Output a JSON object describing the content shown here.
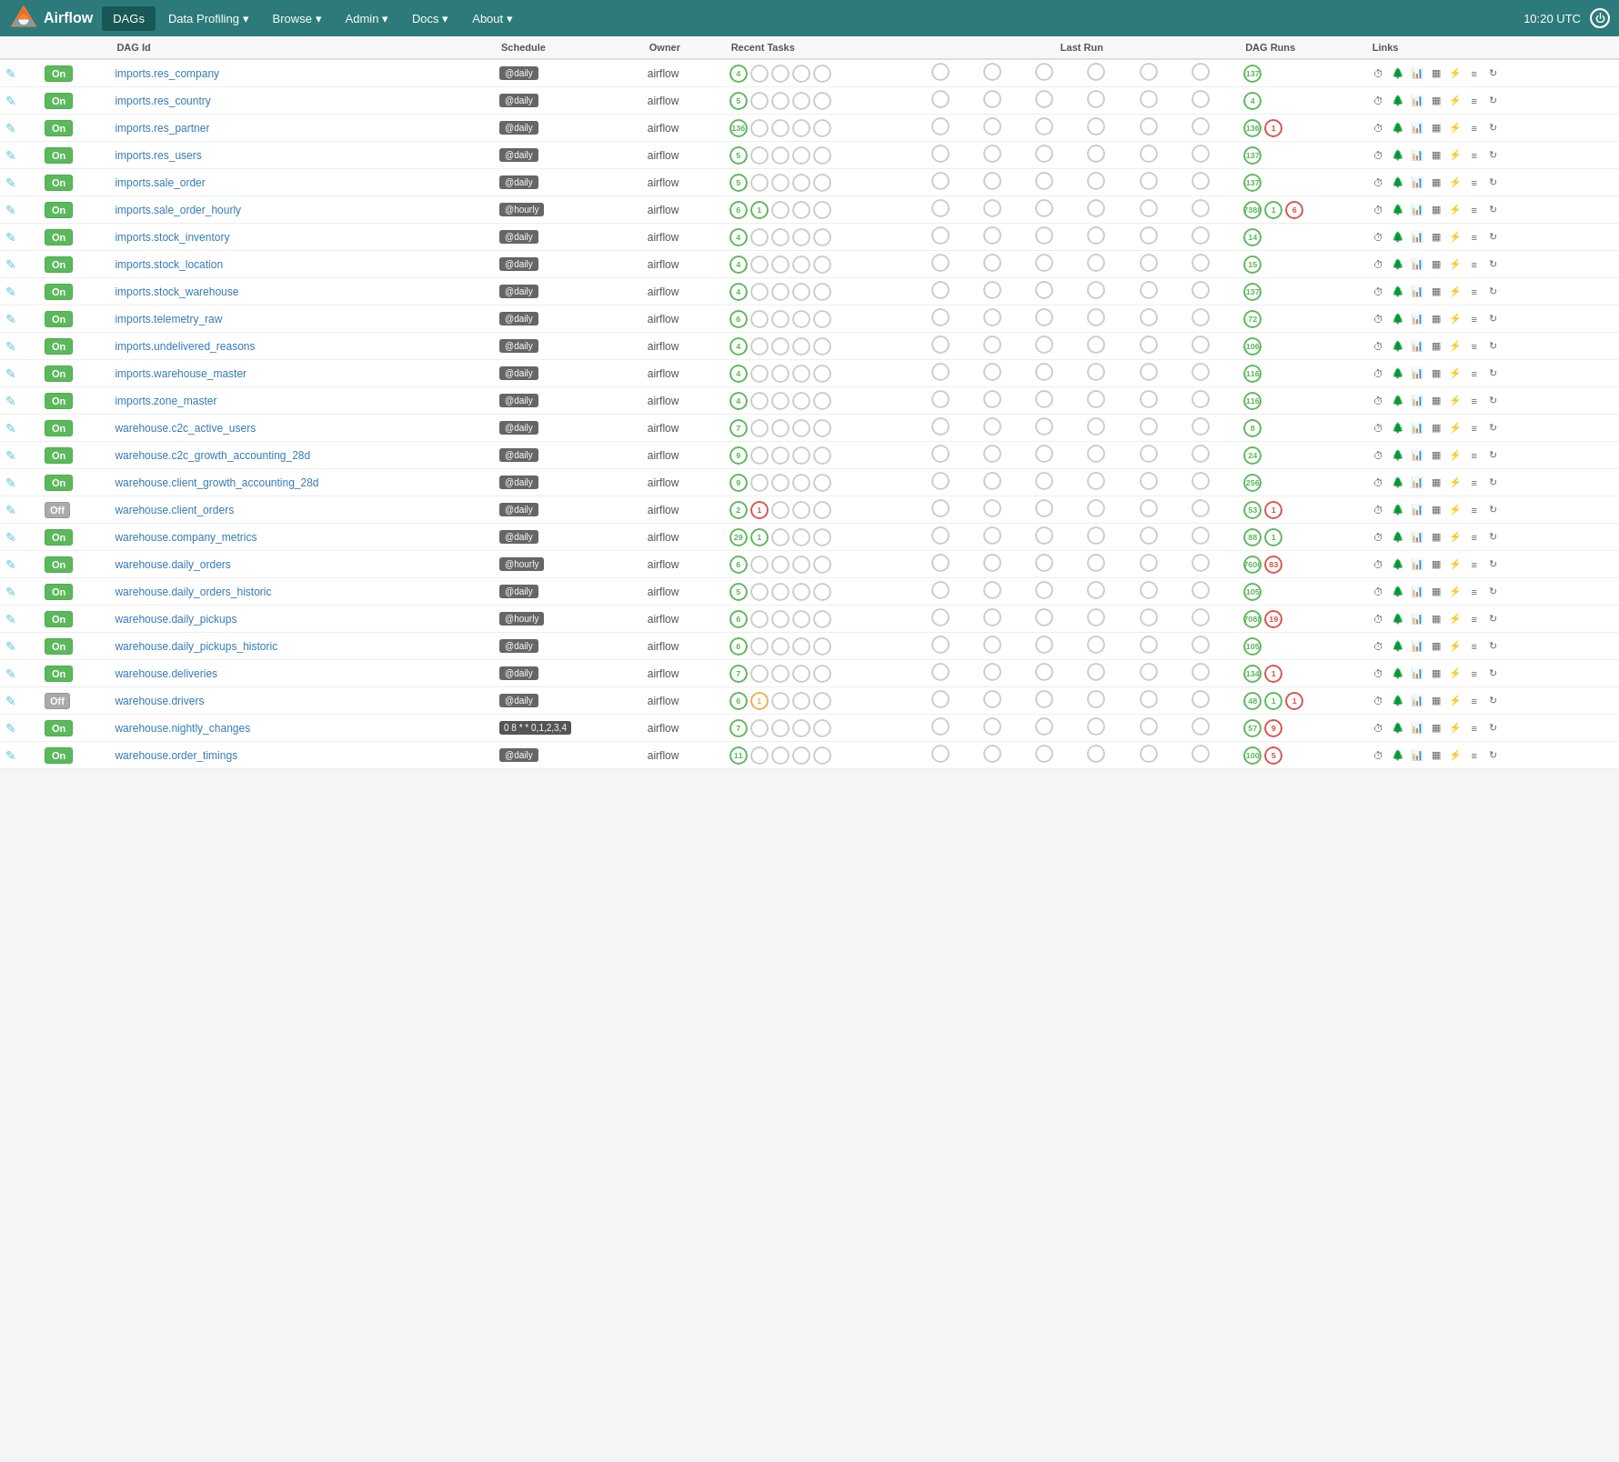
{
  "navbar": {
    "brand": "Airflow",
    "active_tab": "DAGs",
    "items": [
      {
        "label": "DAGs",
        "active": true
      },
      {
        "label": "Data Profiling ▾",
        "active": false
      },
      {
        "label": "Browse ▾",
        "active": false
      },
      {
        "label": "Admin ▾",
        "active": false
      },
      {
        "label": "Docs ▾",
        "active": false
      },
      {
        "label": "About ▾",
        "active": false
      }
    ],
    "time": "10:20 UTC"
  },
  "dags": [
    {
      "name": "imports.res_company",
      "toggle": "On",
      "schedule": "@daily",
      "owner": "airflow",
      "recent": [
        {
          "v": 4,
          "c": "green"
        }
      ],
      "last28": [
        {
          "v": 137,
          "c": "green"
        }
      ],
      "runs_extra": []
    },
    {
      "name": "imports.res_country",
      "toggle": "On",
      "schedule": "@daily",
      "owner": "airflow",
      "recent": [
        {
          "v": 5,
          "c": "green"
        }
      ],
      "last28": [
        {
          "v": 4,
          "c": "green"
        }
      ],
      "runs_extra": []
    },
    {
      "name": "imports.res_partner",
      "toggle": "On",
      "schedule": "@daily",
      "owner": "airflow",
      "recent": [
        {
          "v": 136,
          "c": "green"
        }
      ],
      "last28": [
        {
          "v": 136,
          "c": "green"
        },
        {
          "v": 1,
          "c": "red"
        }
      ],
      "runs_extra": []
    },
    {
      "name": "imports.res_users",
      "toggle": "On",
      "schedule": "@daily",
      "owner": "airflow",
      "recent": [
        {
          "v": 5,
          "c": "green"
        }
      ],
      "last28": [
        {
          "v": 137,
          "c": "green"
        }
      ],
      "runs_extra": []
    },
    {
      "name": "imports.sale_order",
      "toggle": "On",
      "schedule": "@daily",
      "owner": "airflow",
      "recent": [
        {
          "v": 5,
          "c": "green"
        }
      ],
      "last28": [
        {
          "v": 137,
          "c": "green"
        }
      ],
      "runs_extra": []
    },
    {
      "name": "imports.sale_order_hourly",
      "toggle": "On",
      "schedule": "@hourly",
      "owner": "airflow",
      "recent": [
        {
          "v": 6,
          "c": "green"
        },
        {
          "v": 1,
          "c": "green_outline"
        }
      ],
      "last28": [
        {
          "v": 7388,
          "c": "green"
        },
        {
          "v": 1,
          "c": "green_outline"
        },
        {
          "v": 6,
          "c": "red"
        }
      ],
      "runs_extra": []
    },
    {
      "name": "imports.stock_inventory",
      "toggle": "On",
      "schedule": "@daily",
      "owner": "airflow",
      "recent": [
        {
          "v": 4,
          "c": "green"
        }
      ],
      "last28": [
        {
          "v": 14,
          "c": "green"
        }
      ],
      "runs_extra": []
    },
    {
      "name": "imports.stock_location",
      "toggle": "On",
      "schedule": "@daily",
      "owner": "airflow",
      "recent": [
        {
          "v": 4,
          "c": "green"
        }
      ],
      "last28": [
        {
          "v": 15,
          "c": "green"
        }
      ],
      "runs_extra": []
    },
    {
      "name": "imports.stock_warehouse",
      "toggle": "On",
      "schedule": "@daily",
      "owner": "airflow",
      "recent": [
        {
          "v": 4,
          "c": "green"
        }
      ],
      "last28": [
        {
          "v": 137,
          "c": "green"
        }
      ],
      "runs_extra": []
    },
    {
      "name": "imports.telemetry_raw",
      "toggle": "On",
      "schedule": "@daily",
      "owner": "airflow",
      "recent": [
        {
          "v": 6,
          "c": "green"
        }
      ],
      "last28": [
        {
          "v": 72,
          "c": "green"
        }
      ],
      "runs_extra": []
    },
    {
      "name": "imports.undelivered_reasons",
      "toggle": "On",
      "schedule": "@daily",
      "owner": "airflow",
      "recent": [
        {
          "v": 4,
          "c": "green"
        }
      ],
      "last28": [
        {
          "v": 106,
          "c": "green"
        }
      ],
      "runs_extra": []
    },
    {
      "name": "imports.warehouse_master",
      "toggle": "On",
      "schedule": "@daily",
      "owner": "airflow",
      "recent": [
        {
          "v": 4,
          "c": "green"
        }
      ],
      "last28": [
        {
          "v": 116,
          "c": "green"
        }
      ],
      "runs_extra": []
    },
    {
      "name": "imports.zone_master",
      "toggle": "On",
      "schedule": "@daily",
      "owner": "airflow",
      "recent": [
        {
          "v": 4,
          "c": "green"
        }
      ],
      "last28": [
        {
          "v": 116,
          "c": "green"
        }
      ],
      "runs_extra": []
    },
    {
      "name": "warehouse.c2c_active_users",
      "toggle": "On",
      "schedule": "@daily",
      "owner": "airflow",
      "recent": [
        {
          "v": 7,
          "c": "green"
        }
      ],
      "last28": [
        {
          "v": 8,
          "c": "green"
        }
      ],
      "runs_extra": []
    },
    {
      "name": "warehouse.c2c_growth_accounting_28d",
      "toggle": "On",
      "schedule": "@daily",
      "owner": "airflow",
      "recent": [
        {
          "v": 9,
          "c": "green"
        }
      ],
      "last28": [
        {
          "v": 24,
          "c": "green"
        }
      ],
      "runs_extra": []
    },
    {
      "name": "warehouse.client_growth_accounting_28d",
      "toggle": "On",
      "schedule": "@daily",
      "owner": "airflow",
      "recent": [
        {
          "v": 9,
          "c": "green"
        }
      ],
      "last28": [
        {
          "v": 256,
          "c": "green"
        }
      ],
      "runs_extra": []
    },
    {
      "name": "warehouse.client_orders",
      "toggle": "Off",
      "schedule": "@daily",
      "owner": "airflow",
      "recent": [
        {
          "v": 2,
          "c": "green"
        },
        {
          "v": 1,
          "c": "red"
        }
      ],
      "last28": [
        {
          "v": 53,
          "c": "green"
        },
        {
          "v": 1,
          "c": "red"
        }
      ],
      "runs_extra": []
    },
    {
      "name": "warehouse.company_metrics",
      "toggle": "On",
      "schedule": "@daily",
      "owner": "airflow",
      "recent": [
        {
          "v": 29,
          "c": "green"
        },
        {
          "v": 1,
          "c": "green_outline"
        }
      ],
      "last28": [
        {
          "v": 88,
          "c": "green"
        },
        {
          "v": 1,
          "c": "green_outline"
        }
      ],
      "runs_extra": []
    },
    {
      "name": "warehouse.daily_orders",
      "toggle": "On",
      "schedule": "@hourly",
      "owner": "airflow",
      "recent": [
        {
          "v": 6,
          "c": "green"
        }
      ],
      "last28": [
        {
          "v": 7606,
          "c": "green"
        },
        {
          "v": 83,
          "c": "red"
        }
      ],
      "runs_extra": []
    },
    {
      "name": "warehouse.daily_orders_historic",
      "toggle": "On",
      "schedule": "@daily",
      "owner": "airflow",
      "recent": [
        {
          "v": 5,
          "c": "green"
        }
      ],
      "last28": [
        {
          "v": 105,
          "c": "green"
        }
      ],
      "runs_extra": []
    },
    {
      "name": "warehouse.daily_pickups",
      "toggle": "On",
      "schedule": "@hourly",
      "owner": "airflow",
      "recent": [
        {
          "v": 6,
          "c": "green"
        }
      ],
      "last28": [
        {
          "v": 7088,
          "c": "green"
        },
        {
          "v": 19,
          "c": "red"
        }
      ],
      "runs_extra": []
    },
    {
      "name": "warehouse.daily_pickups_historic",
      "toggle": "On",
      "schedule": "@daily",
      "owner": "airflow",
      "recent": [
        {
          "v": 6,
          "c": "green"
        }
      ],
      "last28": [
        {
          "v": 105,
          "c": "green"
        }
      ],
      "runs_extra": []
    },
    {
      "name": "warehouse.deliveries",
      "toggle": "On",
      "schedule": "@daily",
      "owner": "airflow",
      "recent": [
        {
          "v": 7,
          "c": "green"
        }
      ],
      "last28": [
        {
          "v": 134,
          "c": "green"
        },
        {
          "v": 1,
          "c": "red"
        }
      ],
      "runs_extra": []
    },
    {
      "name": "warehouse.drivers",
      "toggle": "Off",
      "schedule": "@daily",
      "owner": "airflow",
      "recent": [
        {
          "v": 6,
          "c": "green"
        },
        {
          "v": 1,
          "c": "yellow"
        }
      ],
      "last28": [
        {
          "v": 48,
          "c": "green"
        },
        {
          "v": 1,
          "c": "green_outline"
        },
        {
          "v": 1,
          "c": "red"
        }
      ],
      "runs_extra": []
    },
    {
      "name": "warehouse.nightly_changes",
      "toggle": "On",
      "schedule": "0 8 * * 0,1,2,3,4",
      "owner": "airflow",
      "recent": [
        {
          "v": 7,
          "c": "green"
        }
      ],
      "last28": [
        {
          "v": 57,
          "c": "green"
        },
        {
          "v": 9,
          "c": "red"
        }
      ],
      "runs_extra": []
    },
    {
      "name": "warehouse.order_timings",
      "toggle": "On",
      "schedule": "@daily",
      "owner": "airflow",
      "recent": [
        {
          "v": 11,
          "c": "green"
        }
      ],
      "last28": [
        {
          "v": 100,
          "c": "green"
        },
        {
          "v": 5,
          "c": "red"
        }
      ],
      "runs_extra": []
    }
  ]
}
